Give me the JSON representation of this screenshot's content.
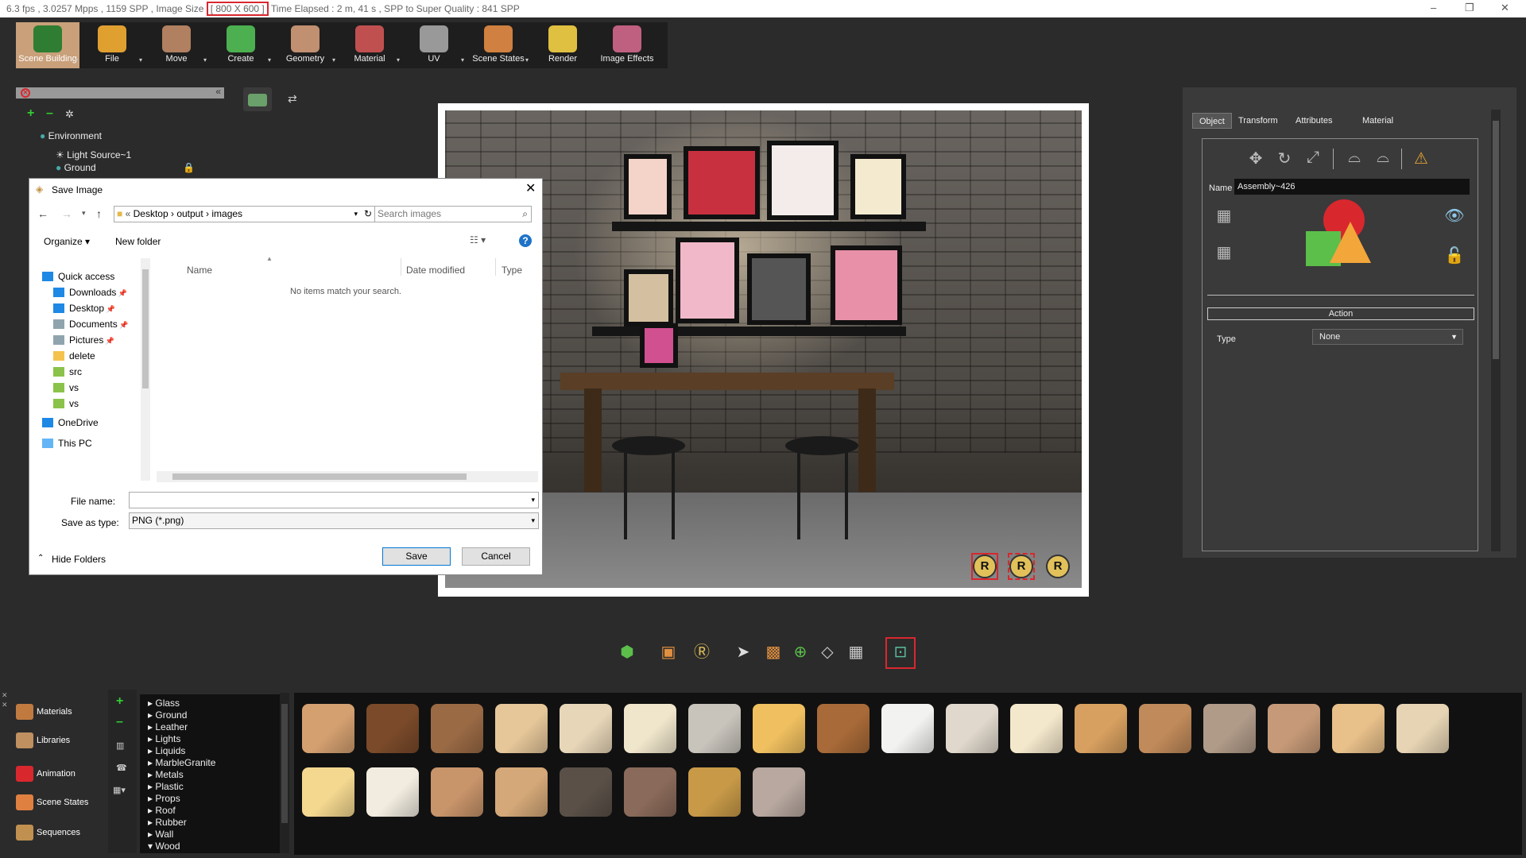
{
  "titlebar": {
    "stats_pre": "6.3 fps ,  3.0257 Mpps  ,  1159 SPP   ,  Image Size",
    "image_size": "[ 800 X 600 ]",
    "stats_post": " Time Elapsed : 2 m, 41 s , SPP to Super Quality : 841 SPP",
    "minimize": "–",
    "restore": "❐",
    "close": "✕"
  },
  "toolbar": {
    "items": [
      {
        "label": "Scene Building",
        "color": "#2e7d32"
      },
      {
        "label": "File",
        "color": "#e0a030"
      },
      {
        "label": "Move",
        "color": "#b08060"
      },
      {
        "label": "Create",
        "color": "#4caf50"
      },
      {
        "label": "Geometry",
        "color": "#c09070"
      },
      {
        "label": "Material",
        "color": "#c05050"
      },
      {
        "label": "UV",
        "color": "#999999"
      },
      {
        "label": "Scene States",
        "color": "#d08040"
      },
      {
        "label": "Render",
        "color": "#e0c040"
      },
      {
        "label": "Image Effects",
        "color": "#c06080"
      }
    ]
  },
  "scene_tree": {
    "environment": "Environment",
    "light": "Light Source~1",
    "ground": "Ground"
  },
  "dialog": {
    "title": "Save Image",
    "path": [
      "Desktop",
      "output",
      "images"
    ],
    "path_prefix": "«",
    "search_placeholder": "Search images",
    "organize": "Organize ▾",
    "new_folder": "New folder",
    "columns": {
      "name": "Name",
      "date": "Date modified",
      "type": "Type"
    },
    "empty_message": "No items match your search.",
    "nav": [
      {
        "label": "Quick access",
        "color": "#1e88e5"
      },
      {
        "label": "Downloads",
        "color": "#1e88e5"
      },
      {
        "label": "Desktop",
        "color": "#1e88e5"
      },
      {
        "label": "Documents",
        "color": "#90a4ae"
      },
      {
        "label": "Pictures",
        "color": "#90a4ae"
      },
      {
        "label": "delete",
        "color": "#f3c34d"
      },
      {
        "label": "src",
        "color": "#8bc34a"
      },
      {
        "label": "vs",
        "color": "#8bc34a"
      },
      {
        "label": "vs",
        "color": "#8bc34a"
      },
      {
        "label": "OneDrive",
        "color": "#1e88e5"
      },
      {
        "label": "This PC",
        "color": "#64b5f6"
      }
    ],
    "file_name_label": "File name:",
    "file_name_value": "",
    "save_type_label": "Save as type:",
    "save_type_value": "PNG (*.png)",
    "hide_folders": "Hide Folders",
    "save": "Save",
    "cancel": "Cancel"
  },
  "properties": {
    "tabs": [
      "Object",
      "Transform",
      "Attributes",
      "Material"
    ],
    "name_label": "Name",
    "name_value": "Assembly~426",
    "action_label": "Action",
    "type_label": "Type",
    "type_value": "None"
  },
  "library": {
    "side": [
      "Materials",
      "Libraries",
      "Animation",
      "Scene States",
      "Sequences"
    ],
    "categories": [
      "Glass",
      "Ground",
      "Leather",
      "Lights",
      "Liquids",
      "MarbleGranite",
      "Metals",
      "Plastic",
      "Props",
      "Roof",
      "Rubber",
      "Wall",
      "Wood"
    ],
    "swatch_colors": [
      "#d4a070",
      "#7a4a2a",
      "#9a6a45",
      "#e6c79a",
      "#e8d6b8",
      "#f0e6cc",
      "#c8c4bc",
      "#f0c060",
      "#a86a38",
      "#f2f2f0",
      "#e0d8cc",
      "#f4e8cc",
      "#d8a060",
      "#c08a5a",
      "#b09a88",
      "#c69a78",
      "#e8c08a",
      "#e6d4b4",
      "#f4d890",
      "#f2ece0",
      "#c8946a",
      "#d4a878",
      "#5a5048",
      "#8a6a5a",
      "#c89a48",
      "#b8a8a0"
    ]
  },
  "colors": {
    "accent": "#d9272e",
    "toolbar_active": "#c9a07a"
  }
}
